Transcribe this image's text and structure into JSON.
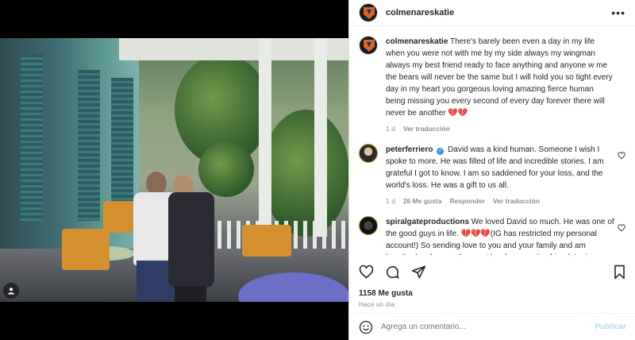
{
  "post": {
    "author": "colmenareskatie",
    "more_icon": "more-horizontal-icon"
  },
  "caption": {
    "user": "colmenareskatie",
    "text": "There's barely been even a day in my life when you were not with me by my side always my wingman always my best friend ready to face anything and anyone w me the bears will never be the same but I will hold you so tight every day in my heart you gorgeous loving amazing fierce human being missing you every second of every day forever there will never be another 💔💔",
    "time": "1 d",
    "reply_label": "Ver traducción"
  },
  "comments": [
    {
      "user": "peterferriero",
      "verified": true,
      "text": "David was a kind human. Someone I wish I spoke to more. He was filled of life and incredible stories. I am grateful I got to know. I am so saddened for your loss, and the world's loss. He was a gift to us all.",
      "time": "1 d",
      "likes": "26 Me gusta",
      "reply": "Responder",
      "translate": "Ver traducción"
    },
    {
      "user": "spiralgateproductions",
      "verified": false,
      "text": "We loved David so much. He was one of the good guys in life. 💔💔💔(IG has restricted my personal account!) So sending love to you and your family and am heartbroken he was the most loyal, supportive friend. I miss"
    }
  ],
  "footer": {
    "likes": "1158 Me gusta",
    "ago": "Hace un día",
    "comment_placeholder": "Agrega un comentario...",
    "publish": "Publicar"
  },
  "colors": {
    "accent": "#3897f0",
    "publish_disabled": "#b2dffc",
    "heart": "#e63c6e"
  }
}
